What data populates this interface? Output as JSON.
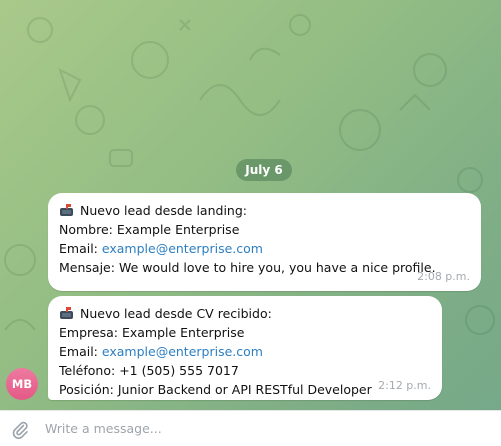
{
  "chat": {
    "date_label": "July 6",
    "messages": [
      {
        "icon": "mailbox-icon",
        "title": "Nuevo lead desde landing:",
        "lines": [
          {
            "label": "Nombre:",
            "value": "Example Enterprise"
          },
          {
            "label": "Email:",
            "value": "example@enterprise.com"
          },
          {
            "label": "Mensaje:",
            "value": "We would love to hire you, you have a nice profile."
          }
        ],
        "time": "2:08 p.m."
      },
      {
        "icon": "mailbox-icon",
        "title": "Nuevo lead desde CV recibido:",
        "lines": [
          {
            "label": "Empresa:",
            "value": "Example Enterprise"
          },
          {
            "label": "Email:",
            "value": "example@enterprise.com"
          },
          {
            "label": "Teléfono:",
            "value": "+1 (505) 555 7017"
          },
          {
            "label": "Posición:",
            "value": "Junior Backend or API RESTful Developer"
          }
        ],
        "time": "2:12 p.m."
      }
    ],
    "sender_initials": "MB"
  },
  "composer": {
    "placeholder": "Write a message...",
    "attach_icon": "paperclip-icon"
  },
  "colors": {
    "background": "#93bd84",
    "link": "#2d7fc2",
    "avatar": "#e86a93",
    "date_pill": "#5f8f68"
  }
}
